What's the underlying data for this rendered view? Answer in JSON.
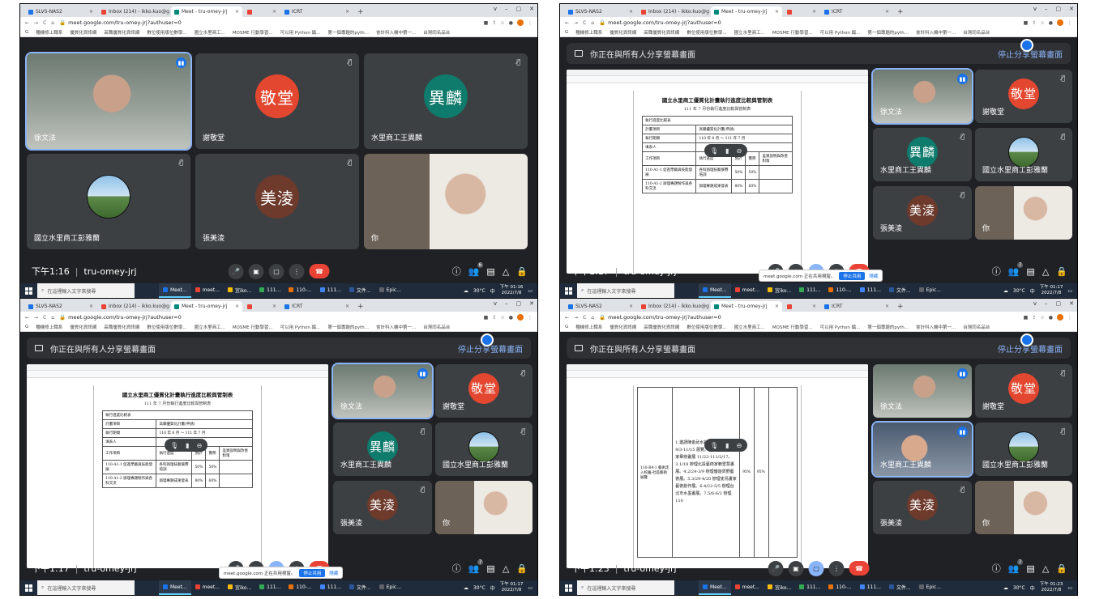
{
  "browser": {
    "tabs": [
      {
        "label": "SLVS-NAS2",
        "color": "#1a73e8",
        "short": false,
        "active": false
      },
      {
        "label": "Inbox (214) - ikko.kuo@gmail",
        "color": "#ea4335",
        "short": false,
        "active": false
      },
      {
        "label": "Meet - tru-omey-jrj",
        "color": "#00897b",
        "short": false,
        "active": true
      },
      {
        "label": "",
        "color": "#ea4335",
        "short": true,
        "active": false
      },
      {
        "label": "ICRT",
        "color": "#1a73e8",
        "short": false,
        "active": false
      }
    ],
    "new_tab": "+",
    "window_controls": [
      "v",
      "–",
      "▢",
      "✕"
    ],
    "url": "meet.google.com/tru-omey-jrj?authuser=0",
    "nav_icons": [
      "←",
      "→",
      "C",
      "⌂"
    ],
    "bookmarks": [
      "G",
      "種機修上職系",
      "優質化資訊網",
      "高職優質化資訊網",
      "數位使用版位數學...",
      "國立水里商工...",
      "MOSME 行動學習...",
      "可以用 Python 編...",
      "第一個專題的pyth...",
      "會計科入機中第一...",
      "台灣同名品台"
    ]
  },
  "meeting": {
    "present_banner": "你正在與所有人分享螢幕畫面",
    "stop_presenting": "停止分享螢幕畫面",
    "participants": {
      "p1": {
        "name": "徐文法"
      },
      "p2": {
        "name": "謝敬堂",
        "initials": "敬堂",
        "color": "#e4472f"
      },
      "p3": {
        "name": "水里商工王異麟",
        "initials": "異麟",
        "color": "#0f7b6c"
      },
      "p4": {
        "name": "國立水里商工彭雅蘭"
      },
      "p5": {
        "name": "張美淩",
        "initials": "美淩",
        "color": "#6d3a2c"
      },
      "p6": {
        "name": "你"
      }
    },
    "meeting_code": "tru-omey-jrj",
    "people_count": "7",
    "people_count_first": "6"
  },
  "shots": [
    {
      "time": "下午1:16",
      "tray_time": "下午 01:16",
      "tray_date": "2022/7/8"
    },
    {
      "time": "下午1:17",
      "tray_time": "下午 01:17",
      "tray_date": "2022/7/8"
    },
    {
      "time": "下午1:17",
      "tray_time": "下午 01:17",
      "tray_date": "2022/7/8"
    },
    {
      "time": "下午1:23",
      "tray_time": "下午 01:23",
      "tray_date": "2022/7/8"
    }
  ],
  "document": {
    "title": "國立水里商工優質化計畫執行進度比較與管制表",
    "subtitle": "111 年 7 月份執行進度比較與管制表",
    "table_header": "執行進度比較表",
    "row_plan_name": "計畫項目",
    "row_plan_value": "高職優質化計畫(申請)",
    "row_period": "執行期間",
    "row_period_value": "110 年 8 月 ～ 111 年 7 月",
    "row_person": "填表人",
    "row_item": "工作項目",
    "col_executed": "執行進度",
    "col_planned": "預計",
    "col_actual": "實際",
    "col_explain": "差異說明與改善對策",
    "item1": "110-A1-1 促進學藝與技能發展",
    "item1_desc": "各科辦理技藝競賽培訓",
    "item2": "110-A1-2 辦理專題製作與各科交流",
    "item2_desc": "辦理專題成果發表",
    "pct50": "50%",
    "pct80": "80%",
    "pct60": "60%",
    "pct95": "95%",
    "item3": "110-B4-1 藝術走入校園-社區藝術展覽",
    "detail_list": "1.邀請陳金武水彩畫家舉辦個展 9/3-11/15 展覽。2.邀請洪諭漆畫家舉辦畫展 11/22-111/2/17。3.1/18 辦理北投藝術家賴雪慧畫展。4.2/24-3/9 辦理優遊郊野藝術展。5.3/29-4/20 辦理雀鳥畫家藝術創作展。6.4/22-5/5 辦理台北市水墨畫展。7.5/6-6/2 辦理 110"
  },
  "share_bar": {
    "text": "meet.google.com 正在共用視窗。",
    "stop": "停止共用",
    "hide": "隱藏"
  },
  "taskbar": {
    "search_placeholder": "在這裡輸入文字來搜尋",
    "apps": [
      "Meet...",
      "meet...",
      "宜iko...",
      "111...",
      "110-...",
      "111...",
      "文件...",
      "Epic..."
    ],
    "weather": "30°C",
    "lang": "中"
  }
}
